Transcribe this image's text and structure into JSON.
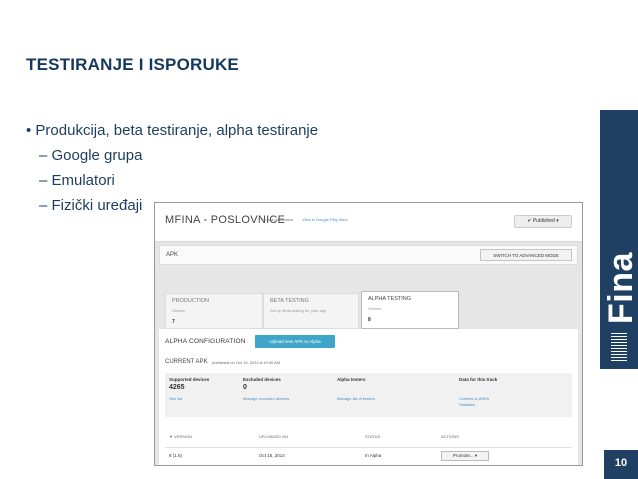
{
  "slide": {
    "title": "TESTIRANJE I ISPORUKE",
    "bullet_main": "• Produkcija, beta testiranje, alpha testiranje",
    "sub_items": [
      "– Google grupa",
      "– Emulatori",
      "– Fizički uređaji"
    ],
    "logo_text": "Fina",
    "page_number": "10"
  },
  "screenshot": {
    "app_title": "MFINA - POSLOVNICE",
    "package": "~ hr.fina.poslovnice",
    "view_link": "View in Google Play store",
    "published_label": "✔  Published  ▾",
    "apk_label": "APK",
    "advanced_button": "SWITCH TO ADVANCED MODE",
    "tabs": [
      {
        "name": "PRODUCTION",
        "sub": "Version",
        "value": "7"
      },
      {
        "name": "BETA TESTING",
        "sub": "Set up Beta testing for your app",
        "value": ""
      },
      {
        "name": "ALPHA TESTING",
        "sub": "Version",
        "value": "8"
      }
    ],
    "alpha_config": "ALPHA CONFIGURATION",
    "upload_button": "Upload new APK to Alpha",
    "current_apk": "CURRENT APK",
    "published_on": "published on Oct 15, 2014 6:19:39 AM",
    "grid": [
      {
        "header": "Supported devices",
        "number": "4265",
        "link": "See list"
      },
      {
        "header": "Excluded devices",
        "number": "0",
        "link": "Manage excluded devices"
      },
      {
        "header": "Alpha testers",
        "number": "",
        "link": "Manage list of testers"
      },
      {
        "header": "Data for this track",
        "number": "",
        "link": "Crashes & ANRs\nStatistics"
      }
    ],
    "table_headers": [
      "▼ VERSION",
      "UPLOADED ON",
      "STATUS",
      "ACTIONS"
    ],
    "row": {
      "version": "8 (1.6)",
      "uploaded": "Oct 15, 2014",
      "status": "In Alpha",
      "action": "Promote...  ▾"
    }
  },
  "colors": {
    "brand": "#1f3f63",
    "title": "#15395e",
    "upload": "#3fa6c9"
  }
}
